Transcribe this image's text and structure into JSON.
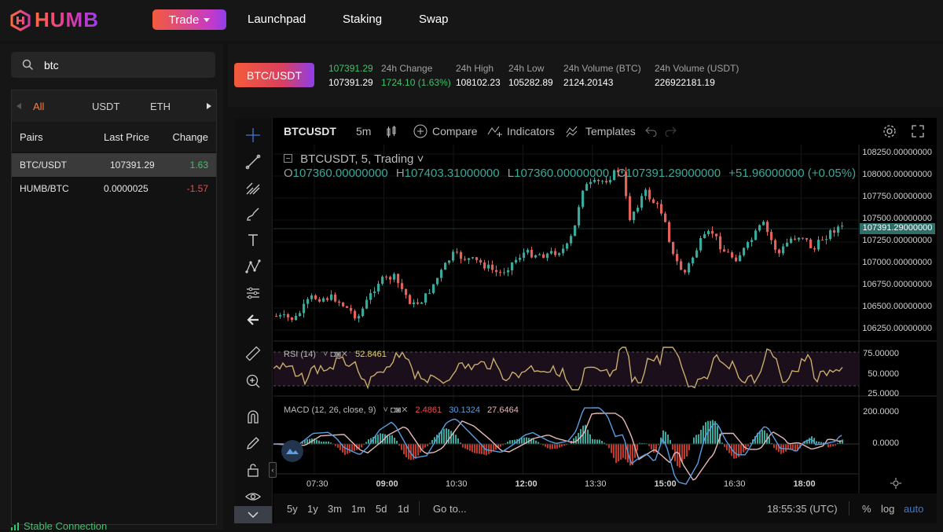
{
  "header": {
    "logo_text": "HUMB",
    "trade_label": "Trade",
    "nav": [
      "Launchpad",
      "Staking",
      "Swap"
    ]
  },
  "sidebar": {
    "search_value": "btc",
    "filters": [
      "All",
      "USDT",
      "ETH"
    ],
    "columns": [
      "Pairs",
      "Last Price",
      "Change"
    ],
    "rows": [
      {
        "pair": "BTC/USDT",
        "price": "107391.29",
        "change": "1.63",
        "color": "#3cc36a"
      },
      {
        "pair": "HUMB/BTC",
        "price": "0.0000025",
        "change": "-1.57",
        "color": "#ef4b4b"
      }
    ],
    "status": "Stable Connection"
  },
  "ticker": {
    "pair": "BTC/USDT",
    "last_price_top": "107391.29",
    "last_price": "107391.29",
    "stats": [
      {
        "label": "24h Change",
        "value": "1724.10 (1.63%)",
        "color": "#3cc36a"
      },
      {
        "label": "24h High",
        "value": "108102.23",
        "color": "#ffffff"
      },
      {
        "label": "24h Low",
        "value": "105282.89",
        "color": "#ffffff"
      },
      {
        "label": "24h Volume (BTC)",
        "value": "2124.20143",
        "color": "#ffffff"
      },
      {
        "label": "24h Volume (USDT)",
        "value": "226922181.19",
        "color": "#ffffff"
      }
    ]
  },
  "chart": {
    "symbol": "BTCUSDT",
    "interval": "5m",
    "compare": "Compare",
    "indicators": "Indicators",
    "templates": "Templates",
    "legend_title": "BTCUSDT, 5, Trading",
    "ohlc": {
      "o": "107360.00000000",
      "h": "107403.31000000",
      "l": "107360.00000000",
      "c": "107391.29000000",
      "chg": "+51.96000000 (+0.05%)"
    },
    "price_axis": [
      "108250.00000000",
      "108000.00000000",
      "107750.00000000",
      "107500.00000000",
      "107250.00000000",
      "107000.00000000",
      "106750.00000000",
      "106500.00000000",
      "106250.00000000"
    ],
    "current_price": "107391.29000000",
    "rsi": {
      "label": "RSI (14)",
      "value": "52.8461",
      "axis": [
        "75.00000",
        "50.0000",
        "25.0000"
      ]
    },
    "macd": {
      "label": "MACD (12, 26, close, 9)",
      "v1": "2.4861",
      "v2": "30.1324",
      "v3": "27.6464",
      "axis": [
        "200.0000",
        "0.0000"
      ]
    },
    "time_axis": [
      "07:30",
      "09:00",
      "10:30",
      "12:00",
      "13:30",
      "15:00",
      "16:30",
      "18:00"
    ],
    "ranges": [
      "5y",
      "1y",
      "3m",
      "1m",
      "5d",
      "1d"
    ],
    "goto": "Go to...",
    "clock": "18:55:35 (UTC)",
    "scale_opts": [
      "%",
      "log",
      "auto"
    ],
    "colors": {
      "up": "#3aa89a",
      "down": "#e0625a",
      "accent": "#3c7bd6"
    }
  }
}
